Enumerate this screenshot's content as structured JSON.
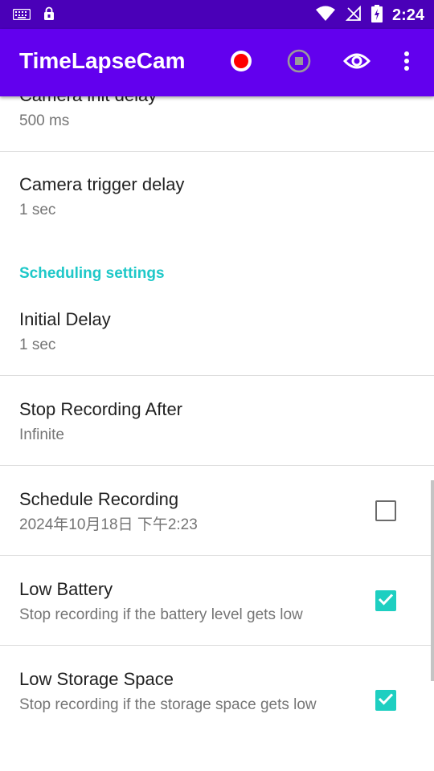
{
  "status": {
    "time": "2:24"
  },
  "app": {
    "title": "TimeLapseCam"
  },
  "icons": {
    "record": "record-icon",
    "stop": "stop-icon",
    "preview": "eye-icon",
    "more": "more-vert-icon"
  },
  "colors": {
    "primary": "#6200ee",
    "status_bar": "#4a00b8",
    "accent": "#1ecfc1",
    "record": "#ff0000"
  },
  "prefs": {
    "camera_init_delay": {
      "title": "Camera init delay",
      "summary": "500 ms"
    },
    "camera_trigger_delay": {
      "title": "Camera trigger delay",
      "summary": "1 sec"
    },
    "scheduling_header": "Scheduling settings",
    "initial_delay": {
      "title": "Initial Delay",
      "summary": "1 sec"
    },
    "stop_recording_after": {
      "title": "Stop Recording After",
      "summary": "Infinite"
    },
    "schedule_recording": {
      "title": "Schedule Recording",
      "summary": "2024年10月18日 下午2:23",
      "checked": false
    },
    "low_battery": {
      "title": "Low Battery",
      "summary": "Stop recording if the battery level gets low",
      "checked": true
    },
    "low_storage": {
      "title": "Low Storage Space",
      "summary": "Stop recording if the storage space gets low",
      "checked": true
    }
  }
}
